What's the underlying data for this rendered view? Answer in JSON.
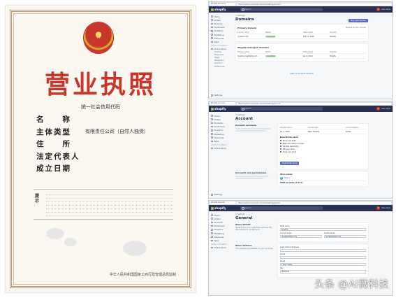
{
  "license": {
    "emblem": "national-emblem",
    "title": "营业执照",
    "credit_code_label": "统一社会信用代码",
    "fields": [
      {
        "label": "名　　称",
        "value": ""
      },
      {
        "label": "主体类型",
        "value": "有限责任公司（自然人独资）"
      },
      {
        "label": "住　　所",
        "value": ""
      },
      {
        "label": "法定代表人",
        "value": ""
      },
      {
        "label": "成立日期",
        "value": ""
      }
    ],
    "notice_head": "提示",
    "footer": "中华人民共和国国家工商行政管理总局监制"
  },
  "shots": [
    {
      "browser_tab": "Shopify Domains",
      "url": "https://mystore.myshopify.com/admin/settings/domains",
      "brand": "shopify",
      "search_placeholder": "Search",
      "avatar_initial": "R",
      "store_name": "Rain store",
      "sidebar": [
        "Home",
        "Orders",
        "Products",
        "Customers",
        "Analytics",
        "Marketing",
        "Discounts",
        "Apps"
      ],
      "channels_label": "SALES CHANNELS",
      "channels": [
        "Online Store"
      ],
      "channel_subs": [
        "Themes",
        "Blog posts",
        "Pages",
        "Navigation",
        "Domains",
        "Preferences"
      ],
      "settings_label": "Settings",
      "crumb": "< Settings",
      "title": "Domains",
      "top_button": "Buy new domain",
      "primary_card": {
        "heading": "Primary domain",
        "link": "Change primary domain",
        "headers": [
          "Domain name",
          "Status",
          "Date added",
          "Provider"
        ],
        "row": [
          "mystore.com",
          "Connected",
          "Feb 14, 2019",
          "Shopify"
        ]
      },
      "managed_card": {
        "heading": "Shopify-managed domains",
        "headers": [
          "Domain name",
          "Status",
          "Date added",
          "Provider"
        ],
        "row": [
          "mystore.myshopify.com",
          "Connected",
          "Jan 2, 2019",
          "Shopify"
        ]
      },
      "help_link": "Learn more about domains"
    },
    {
      "browser_tab": "Shopify Account",
      "url": "https://mystore.myshopify.com/admin/settings/account",
      "brand": "shopify",
      "search_placeholder": "Search",
      "avatar_initial": "R",
      "store_name": "Rain store",
      "sidebar": [
        "Home",
        "Orders",
        "Products",
        "Customers",
        "Analytics",
        "Marketing",
        "Discounts",
        "Apps"
      ],
      "channels_label": "SALES CHANNELS",
      "channels": [
        "Online Store"
      ],
      "settings_label": "Settings",
      "crumb": "< Settings",
      "title": "Account",
      "overview_heading": "Account overview",
      "overview_cols": [
        "Member since",
        "Current plan",
        "Account status"
      ],
      "overview_vals": [
        "Jan 2, 2019",
        "Basic Shopify",
        "Active"
      ],
      "deactivate_heading": "Deactivate store",
      "options": [
        "Pause and build",
        "Keep your store on a plan",
        "Transfer ownership",
        "Sell your store",
        "Close your store"
      ],
      "deactivate_button": "Deactivate store",
      "owner_heading": "Accounts and permissions",
      "owner_label": "Store owner",
      "owner_name": "Rain A.",
      "staff_heading": "Staff accounts (0 of 2)"
    },
    {
      "browser_tab": "Shopify General",
      "url": "https://mystore.myshopify.com/admin/settings/general",
      "brand": "shopify",
      "search_placeholder": "Search",
      "avatar_initial": "R",
      "store_name": "Rain store",
      "sidebar": [
        "Home",
        "Orders",
        "Products",
        "Customers",
        "Analytics",
        "Marketing",
        "Discounts",
        "Apps"
      ],
      "channels_label": "SALES CHANNELS",
      "channels": [
        "Online Store"
      ],
      "settings_label": "Settings",
      "crumb": "< Settings",
      "title": "General",
      "store_details": {
        "heading": "Store details",
        "desc": "Shopify and your customers will use this information to contact you.",
        "store_name_label": "Store name",
        "store_name": "mystore",
        "email_label": "Account email",
        "email": "rain@example.com",
        "sender_label": "Sender email",
        "sender": "rain@example.com"
      },
      "address": {
        "heading": "Store address",
        "desc": "This address will appear on your invoices.",
        "legal_label": "Legal name of business",
        "phone_label": "Phone",
        "street_label": "Street",
        "street": "1 Main Street",
        "city_label": "City",
        "city": "Shanghai"
      }
    }
  ],
  "watermark": "头条 @AI微科技"
}
